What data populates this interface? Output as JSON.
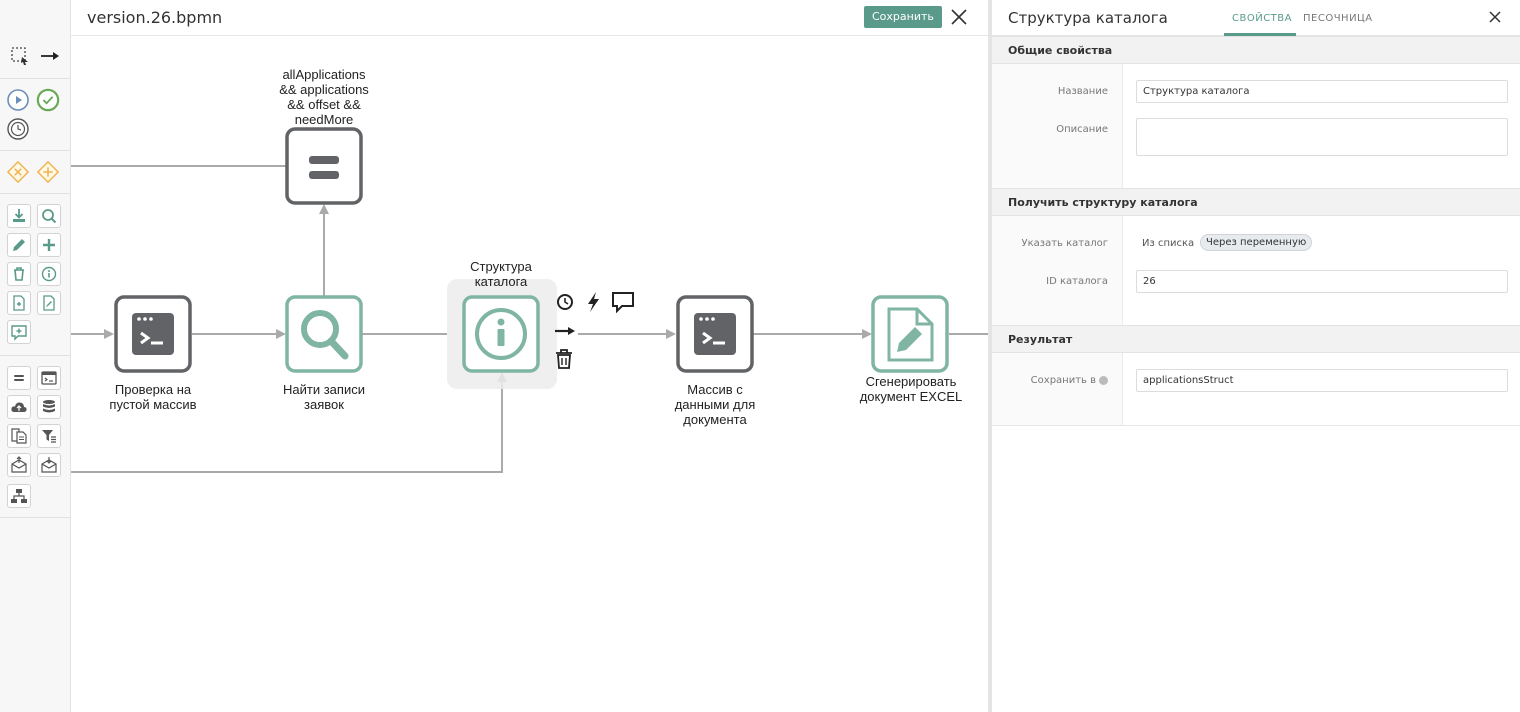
{
  "editor": {
    "file_title": "version.26.bpmn",
    "save_label": "Сохранить"
  },
  "colors": {
    "accent": "#5a9a8a",
    "task_dark": "#616366",
    "task_green": "#7fb5a2",
    "flow_line": "#aaaaaa"
  },
  "palette": {
    "tools": [
      {
        "icon": "lasso-select-icon"
      },
      {
        "icon": "connect-arrow-icon"
      },
      {
        "icon": "start-event-icon"
      },
      {
        "icon": "end-event-icon"
      },
      {
        "icon": "timer-event-icon"
      },
      {
        "icon": "exclusive-gateway-icon"
      },
      {
        "icon": "parallel-gateway-icon"
      },
      {
        "icon": "download-task-icon"
      },
      {
        "icon": "search-task-icon"
      },
      {
        "icon": "edit-task-icon"
      },
      {
        "icon": "add-task-icon"
      },
      {
        "icon": "delete-task-icon"
      },
      {
        "icon": "info-task-icon"
      },
      {
        "icon": "file-task-icon"
      },
      {
        "icon": "file-edit-task-icon"
      },
      {
        "icon": "message-task-icon"
      },
      {
        "icon": "equals-task-icon"
      },
      {
        "icon": "script-task-icon"
      },
      {
        "icon": "cloud-upload-task-icon"
      },
      {
        "icon": "database-task-icon"
      },
      {
        "icon": "document-copy-task-icon"
      },
      {
        "icon": "filter-task-icon"
      },
      {
        "icon": "mail-send-task-icon"
      },
      {
        "icon": "mail-receive-task-icon"
      },
      {
        "icon": "subprocess-icon"
      }
    ]
  },
  "diagram": {
    "nodes": [
      {
        "id": "condition",
        "label_lines": [
          "allApplications",
          "&& applications",
          "&& offset &&",
          "needMore"
        ],
        "icon": "equals-icon"
      },
      {
        "id": "check-empty",
        "label_lines": [
          "Проверка на",
          "пустой массив"
        ],
        "icon": "script-icon"
      },
      {
        "id": "find-records",
        "label_lines": [
          "Найти записи",
          "заявок"
        ],
        "icon": "search-icon"
      },
      {
        "id": "catalog-structure",
        "label_lines": [
          "Структура",
          "каталога"
        ],
        "icon": "info-icon"
      },
      {
        "id": "data-array",
        "label_lines": [
          "Массив с",
          "данными для",
          "документа"
        ],
        "icon": "script-icon"
      },
      {
        "id": "generate-excel",
        "label_lines": [
          "Сгенерировать",
          "документ EXCEL"
        ],
        "icon": "file-edit-icon"
      }
    ],
    "context_pad": [
      "timer-icon",
      "lightning-icon",
      "comment-icon",
      "arrow-icon",
      "trash-icon"
    ]
  },
  "panel": {
    "title": "Структура каталога",
    "tabs": [
      {
        "label": "СВОЙСТВА",
        "active": true
      },
      {
        "label": "ПЕСОЧНИЦА",
        "active": false
      }
    ],
    "sections": [
      {
        "title": "Общие свойства",
        "fields": [
          {
            "label": "Название",
            "value": "Структура каталога"
          },
          {
            "label": "Описание",
            "value": ""
          }
        ]
      },
      {
        "title": "Получить структуру каталога",
        "fields": [
          {
            "label": "Указать каталог",
            "options": [
              "Из списка",
              "Через переменную"
            ],
            "selected": "Через переменную"
          },
          {
            "label": "ID каталога",
            "value": "26"
          }
        ]
      },
      {
        "title": "Результат",
        "fields": [
          {
            "label": "Сохранить в",
            "value": "applicationsStruct"
          }
        ]
      }
    ]
  }
}
